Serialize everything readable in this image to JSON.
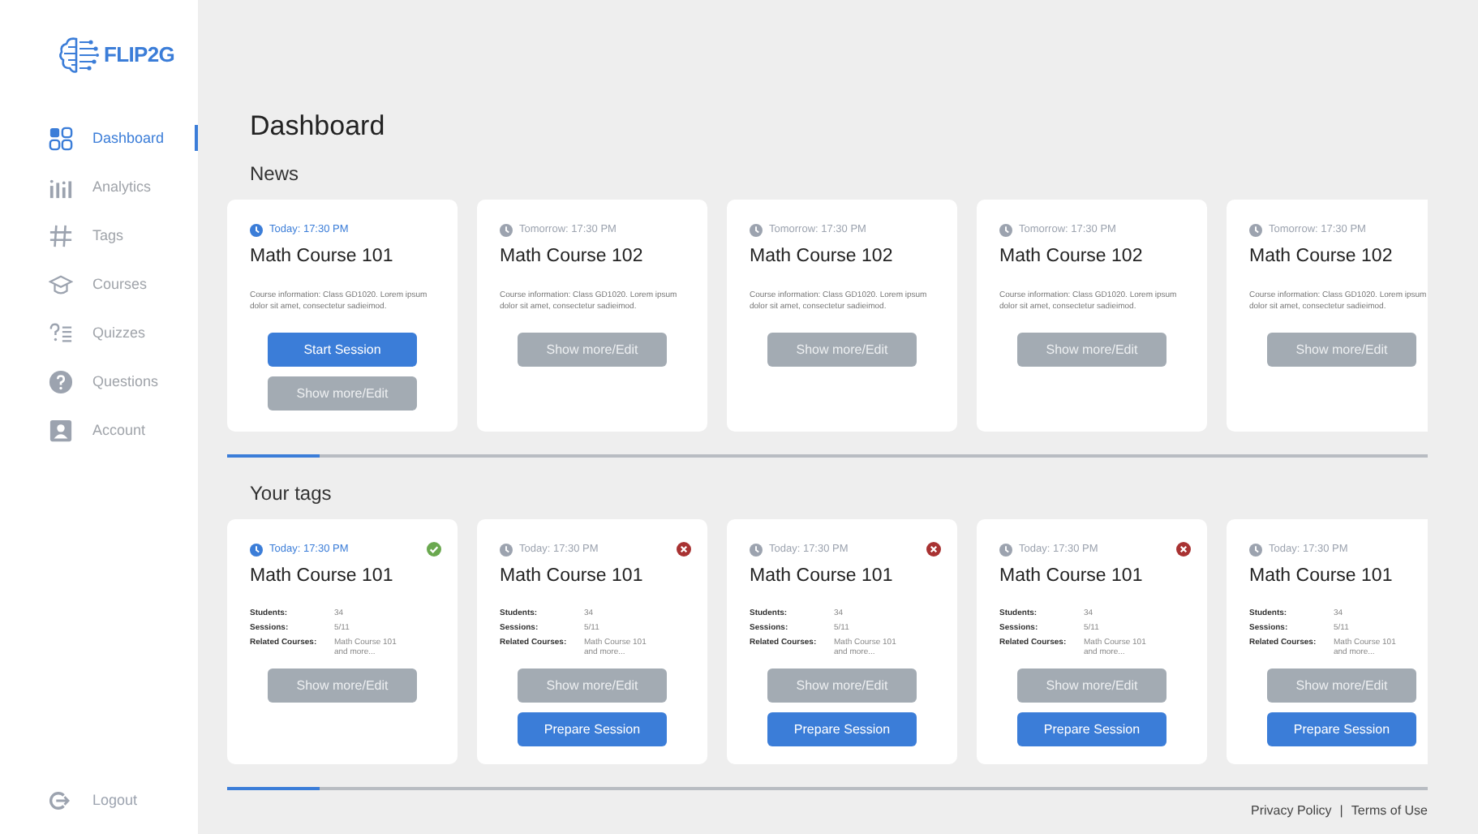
{
  "sidebar": {
    "logo": "FLIP2G",
    "items": [
      {
        "label": "Dashboard",
        "selected": true
      },
      {
        "label": "Analytics",
        "selected": false
      },
      {
        "label": "Tags",
        "selected": false
      },
      {
        "label": "Courses",
        "selected": false
      },
      {
        "label": "Quizzes",
        "selected": false
      },
      {
        "label": "Questions",
        "selected": false
      },
      {
        "label": "Account",
        "selected": false
      }
    ],
    "logout": "Logout"
  },
  "title": "Dashboard",
  "news": {
    "heading": "News",
    "cards": [
      {
        "time": "Today: 17:30 PM",
        "highlighted": true,
        "title": "Math Course 101",
        "description": "Course information: Class GD1020. Lorem ipsum dolor sit amet, consectetur sadieimod.",
        "buttons": [
          {
            "label": "Start Session",
            "kind": "primary"
          },
          {
            "label": "Show more/Edit",
            "kind": "secondary"
          }
        ]
      },
      {
        "time": "Tomorrow: 17:30 PM",
        "highlighted": false,
        "title": "Math Course 102",
        "description": "Course information: Class GD1020. Lorem ipsum dolor sit amet, consectetur sadieimod.",
        "buttons": [
          {
            "label": "Show more/Edit",
            "kind": "secondary"
          }
        ]
      },
      {
        "time": "Tomorrow: 17:30 PM",
        "highlighted": false,
        "title": "Math Course 102",
        "description": "Course information: Class GD1020. Lorem ipsum dolor sit amet, consectetur sadieimod.",
        "buttons": [
          {
            "label": "Show more/Edit",
            "kind": "secondary"
          }
        ]
      },
      {
        "time": "Tomorrow: 17:30 PM",
        "highlighted": false,
        "title": "Math Course 102",
        "description": "Course information: Class GD1020. Lorem ipsum dolor sit amet, consectetur sadieimod.",
        "buttons": [
          {
            "label": "Show more/Edit",
            "kind": "secondary"
          }
        ]
      },
      {
        "time": "Tomorrow: 17:30 PM",
        "highlighted": false,
        "title": "Math Course 102",
        "description": "Course information: Class GD1020. Lorem ipsum dolor sit amet, consectetur sadieimod.",
        "buttons": [
          {
            "label": "Show more/Edit",
            "kind": "secondary"
          }
        ]
      }
    ]
  },
  "tags": {
    "heading": "Your tags",
    "cards": [
      {
        "time": "Today: 17:30 PM",
        "highlighted": true,
        "kind": "confirmed",
        "title": "Math Course 101",
        "details": [
          {
            "label": "Students:",
            "value": "34"
          },
          {
            "label": "Sessions:",
            "value": "5/11"
          },
          {
            "label": "Related Courses:",
            "value": "Math Course 101 and more..."
          }
        ],
        "buttons": [
          {
            "label": "Show more/Edit",
            "kind": "secondary"
          }
        ]
      },
      {
        "time": "Today: 17:30 PM",
        "highlighted": false,
        "kind": "rejected",
        "title": "Math Course 101",
        "details": [
          {
            "label": "Students:",
            "value": "34"
          },
          {
            "label": "Sessions:",
            "value": "5/11"
          },
          {
            "label": "Related Courses:",
            "value": "Math Course 101 and more..."
          }
        ],
        "buttons": [
          {
            "label": "Show more/Edit",
            "kind": "secondary"
          },
          {
            "label": "Prepare Session",
            "kind": "primary"
          }
        ]
      },
      {
        "time": "Today: 17:30 PM",
        "highlighted": false,
        "kind": "rejected",
        "title": "Math Course 101",
        "details": [
          {
            "label": "Students:",
            "value": "34"
          },
          {
            "label": "Sessions:",
            "value": "5/11"
          },
          {
            "label": "Related Courses:",
            "value": "Math Course 101 and more..."
          }
        ],
        "buttons": [
          {
            "label": "Show more/Edit",
            "kind": "secondary"
          },
          {
            "label": "Prepare Session",
            "kind": "primary"
          }
        ]
      },
      {
        "time": "Today: 17:30 PM",
        "highlighted": false,
        "kind": "rejected",
        "title": "Math Course 101",
        "details": [
          {
            "label": "Students:",
            "value": "34"
          },
          {
            "label": "Sessions:",
            "value": "5/11"
          },
          {
            "label": "Related Courses:",
            "value": "Math Course 101 and more..."
          }
        ],
        "buttons": [
          {
            "label": "Show more/Edit",
            "kind": "secondary"
          },
          {
            "label": "Prepare Session",
            "kind": "primary"
          }
        ]
      },
      {
        "time": "Today: 17:30 PM",
        "highlighted": false,
        "kind": "plain",
        "title": "Math Course 101",
        "details": [
          {
            "label": "Students:",
            "value": "34"
          },
          {
            "label": "Sessions:",
            "value": "5/11"
          },
          {
            "label": "Related Courses:",
            "value": "Math Course 101 and more..."
          }
        ],
        "buttons": [
          {
            "label": "Show more/Edit",
            "kind": "secondary"
          },
          {
            "label": "Prepare Session",
            "kind": "primary"
          }
        ]
      }
    ]
  },
  "footer": {
    "links": [
      "Privacy Policy",
      "Terms of Use"
    ],
    "separator": "|"
  }
}
